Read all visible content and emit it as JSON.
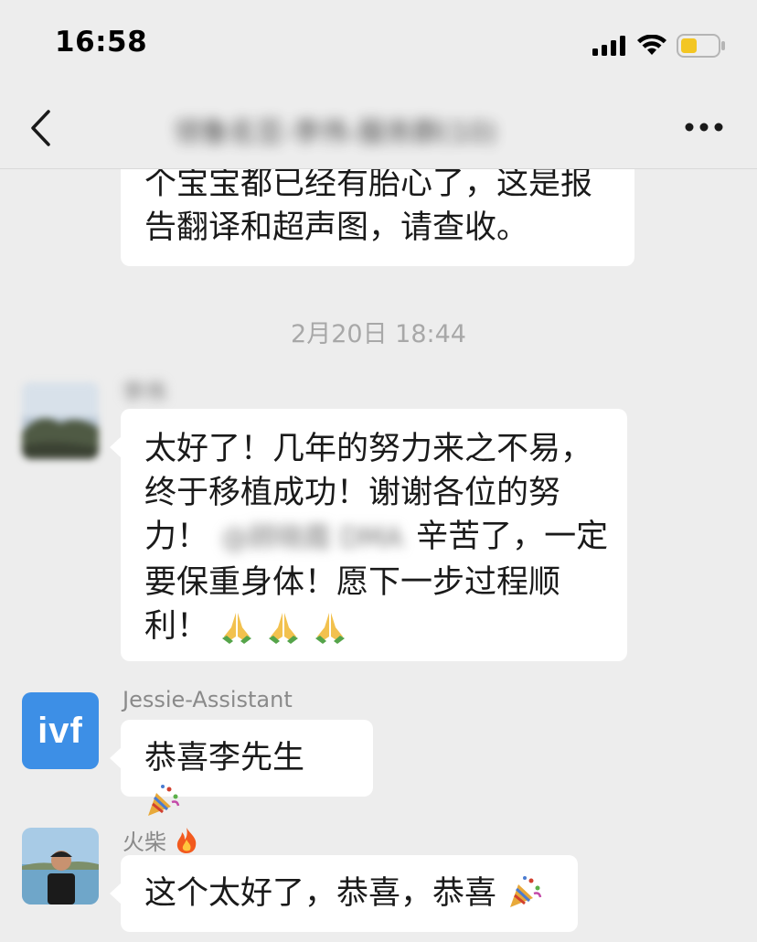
{
  "status_bar": {
    "time": "16:58"
  },
  "nav": {
    "title": "领鲁名豆-李伟-服务群(10)"
  },
  "messages": [
    {
      "text_lines": [
        "个宝宝都已经有胎心了，这是报",
        "告翻译和超声图，请查收。"
      ]
    },
    {
      "timestamp": "2月20日 18:44"
    },
    {
      "sender": "李伟",
      "line1": "太好了！几年的努力来之不易，",
      "line2": "终于移植成功！谢谢各位的努",
      "line3_prefix": "力！",
      "line3_blurred": "@顾晓霞 DMA",
      "line3_suffix": "辛苦了，一定",
      "line4": "要保重身体！愿下一步过程顺",
      "line5": "利！",
      "emoji_names": [
        "folded-hands",
        "folded-hands",
        "folded-hands"
      ]
    },
    {
      "sender": "Jessie-Assistant",
      "avatar_text": "ivf",
      "text": "恭喜李先生",
      "emoji_name": "party-popper"
    },
    {
      "sender": "火柴",
      "sender_emoji": "fire",
      "text": "这个太好了，恭喜，恭喜",
      "emoji_name": "party-popper"
    }
  ],
  "colors": {
    "background": "#ededed",
    "bubble": "#ffffff",
    "ivf_avatar": "#3d8fe6"
  }
}
